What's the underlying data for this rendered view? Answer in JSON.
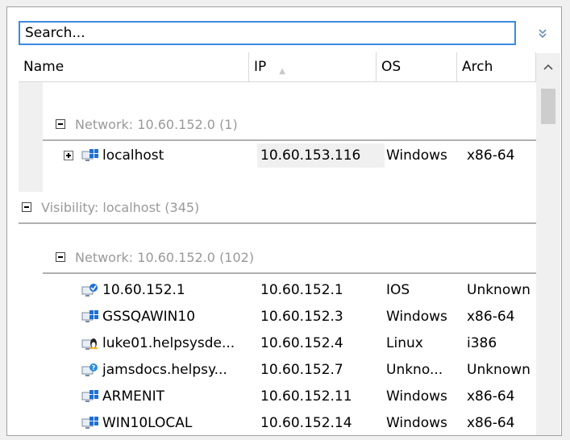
{
  "search": {
    "placeholder": "Search..."
  },
  "columns": [
    {
      "label": "Name"
    },
    {
      "label": "IP"
    },
    {
      "label": "OS"
    },
    {
      "label": "Arch"
    }
  ],
  "groups": {
    "network_top": {
      "label": "Network: 10.60.152.0 (1)"
    },
    "visibility": {
      "label": "Visibility: localhost (345)"
    },
    "network_main": {
      "label": "Network: 10.60.152.0 (102)"
    }
  },
  "localhost_row": {
    "name": "localhost",
    "ip": "10.60.153.116",
    "os": "Windows",
    "arch": "x86-64",
    "icon": "windows-computer-icon"
  },
  "devices": [
    {
      "name": "10.60.152.1",
      "ip": "10.60.152.1",
      "os": "IOS",
      "arch": "Unknown",
      "icon": "cisco-device-icon"
    },
    {
      "name": "GSSQAWIN10",
      "ip": "10.60.152.3",
      "os": "Windows",
      "arch": "x86-64",
      "icon": "windows-computer-icon"
    },
    {
      "name": "luke01.helpsysde...",
      "ip": "10.60.152.4",
      "os": "Linux",
      "arch": "i386",
      "icon": "linux-computer-icon"
    },
    {
      "name": "jamsdocs.helpsy...",
      "ip": "10.60.152.7",
      "os": "Unkno...",
      "arch": "Unknown",
      "icon": "unknown-computer-icon"
    },
    {
      "name": "ARMENIT",
      "ip": "10.60.152.11",
      "os": "Windows",
      "arch": "x86-64",
      "icon": "windows-computer-icon"
    },
    {
      "name": "WIN10LOCAL",
      "ip": "10.60.152.14",
      "os": "Windows",
      "arch": "x86-64",
      "icon": "windows-computer-icon"
    }
  ],
  "colors": {
    "search_border": "#3a8ae0",
    "group_text": "#999999",
    "windows_blue": "#1e6fd6"
  }
}
